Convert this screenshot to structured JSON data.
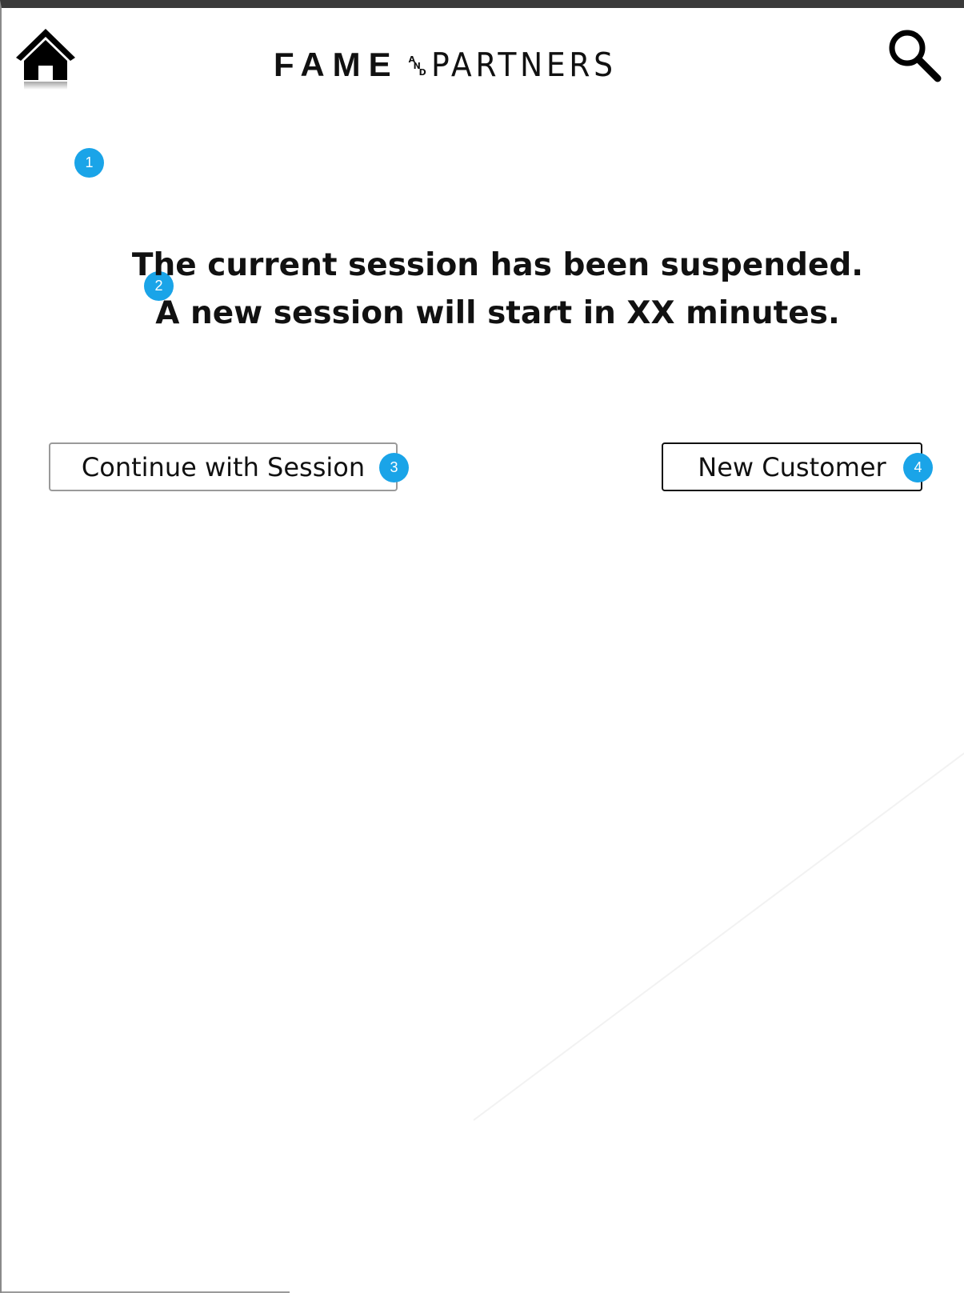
{
  "header": {
    "home_icon": "home-icon",
    "search_icon": "search-icon",
    "logo": {
      "word_left": "FAME",
      "and_letters": [
        "A",
        "N",
        "D"
      ],
      "word_right": "PARTNERS"
    }
  },
  "annotations": [
    "1",
    "2",
    "3",
    "4"
  ],
  "message": {
    "line1": "The current session has been suspended.",
    "line2": "A new session will start in XX minutes."
  },
  "buttons": {
    "continue_label": "Continue with Session",
    "new_customer_label": "New Customer"
  },
  "colors": {
    "badge": "#1aa4e8",
    "text": "#111111",
    "frame_top": "#3a3a3a"
  }
}
